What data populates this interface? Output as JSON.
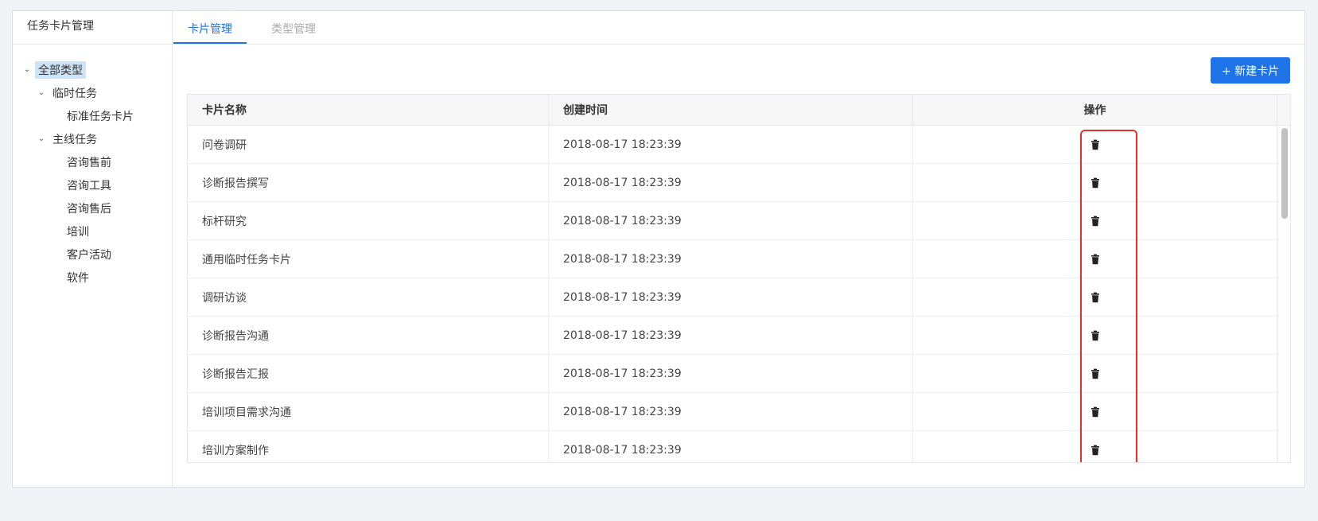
{
  "sidebar": {
    "title": "任务卡片管理",
    "tree": [
      {
        "label": "全部类型",
        "level": 0,
        "expanded": true,
        "selected": true
      },
      {
        "label": "临时任务",
        "level": 1,
        "expanded": true
      },
      {
        "label": "标准任务卡片",
        "level": 2
      },
      {
        "label": "主线任务",
        "level": 1,
        "expanded": true
      },
      {
        "label": "咨询售前",
        "level": 2
      },
      {
        "label": "咨询工具",
        "level": 2
      },
      {
        "label": "咨询售后",
        "level": 2
      },
      {
        "label": "培训",
        "level": 2
      },
      {
        "label": "客户活动",
        "level": 2
      },
      {
        "label": "软件",
        "level": 2
      }
    ]
  },
  "tabs": [
    {
      "label": "卡片管理",
      "active": true
    },
    {
      "label": "类型管理",
      "active": false
    }
  ],
  "toolbar": {
    "new_card_label": "+ 新建卡片"
  },
  "table": {
    "columns": [
      "卡片名称",
      "创建时间",
      "操作"
    ],
    "rows": [
      {
        "name": "问卷调研",
        "created": "2018-08-17 18:23:39"
      },
      {
        "name": "诊断报告撰写",
        "created": "2018-08-17 18:23:39"
      },
      {
        "name": "标杆研究",
        "created": "2018-08-17 18:23:39"
      },
      {
        "name": "通用临时任务卡片",
        "created": "2018-08-17 18:23:39"
      },
      {
        "name": "调研访谈",
        "created": "2018-08-17 18:23:39"
      },
      {
        "name": "诊断报告沟通",
        "created": "2018-08-17 18:23:39"
      },
      {
        "name": "诊断报告汇报",
        "created": "2018-08-17 18:23:39"
      },
      {
        "name": "培训项目需求沟通",
        "created": "2018-08-17 18:23:39"
      },
      {
        "name": "培训方案制作",
        "created": "2018-08-17 18:23:39"
      }
    ],
    "action_icon": "trash-icon"
  },
  "colors": {
    "accent": "#1e73e8",
    "highlight": "#e8302a",
    "selected_bg": "#cfe3f7"
  }
}
